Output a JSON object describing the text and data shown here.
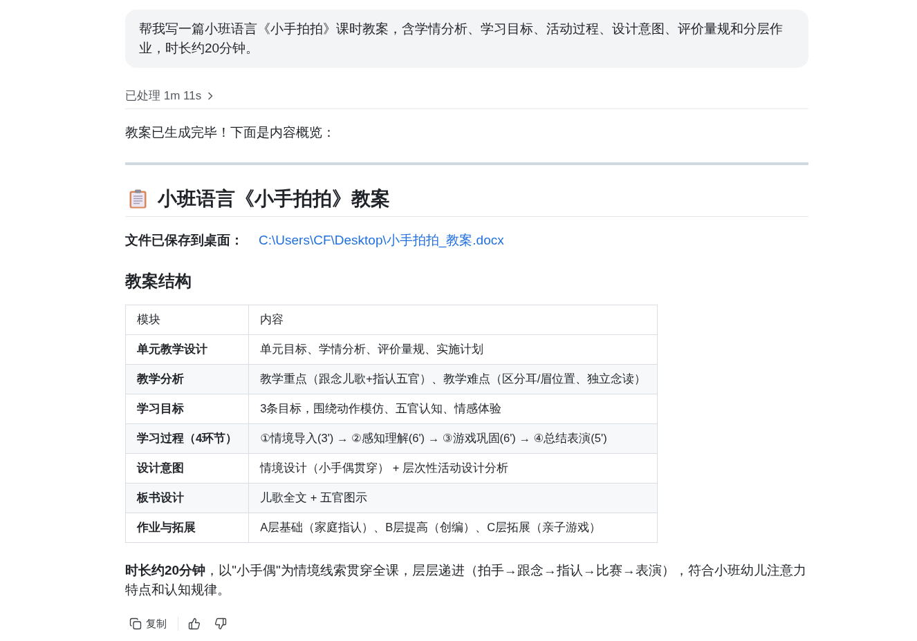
{
  "prompt": {
    "text": "帮我写一篇小班语言《小手拍拍》课时教案，含学情分析、学习目标、活动过程、设计意图、评价量规和分层作业，时长约20分钟。"
  },
  "processing": {
    "label": "已处理 1m 11s",
    "expanded": false
  },
  "reply": {
    "intro": "教案已生成完毕！下面是内容概览：",
    "title": "小班语言《小手拍拍》教案",
    "file": {
      "label": "文件已保存到桌面：",
      "path": "C:\\Users\\CF\\Desktop\\小手拍拍_教案.docx"
    },
    "section_title": "教案结构",
    "table": {
      "columns": [
        "模块",
        "内容"
      ],
      "rows": [
        [
          "单元教学设计",
          "单元目标、学情分析、评价量规、实施计划"
        ],
        [
          "教学分析",
          "教学重点（跟念儿歌+指认五官）、教学难点（区分耳/眉位置、独立念读）"
        ],
        [
          "学习目标",
          "3条目标，围绕动作模仿、五官认知、情感体验"
        ],
        [
          "学习过程（4环节）",
          "①情境导入(3') → ②感知理解(6') → ③游戏巩固(6') → ④总结表演(5')"
        ],
        [
          "设计意图",
          "情境设计（小手偶贯穿） + 层次性活动设计分析"
        ],
        [
          "板书设计",
          "儿歌全文 + 五官图示"
        ],
        [
          "作业与拓展",
          "A层基础（家庭指认）、B层提高（创编）、C层拓展（亲子游戏）"
        ]
      ]
    },
    "summary": "**时长约20分钟**，以\"小手偶\"为情境线索贯穿全课，层层递进（拍手→跟念→指认→比赛→表演），符合小班幼儿注意力特点和认知规律。"
  },
  "actions": [
    {
      "kind": "copy",
      "label": "复制"
    },
    {
      "kind": "like"
    },
    {
      "kind": "dislike"
    }
  ]
}
